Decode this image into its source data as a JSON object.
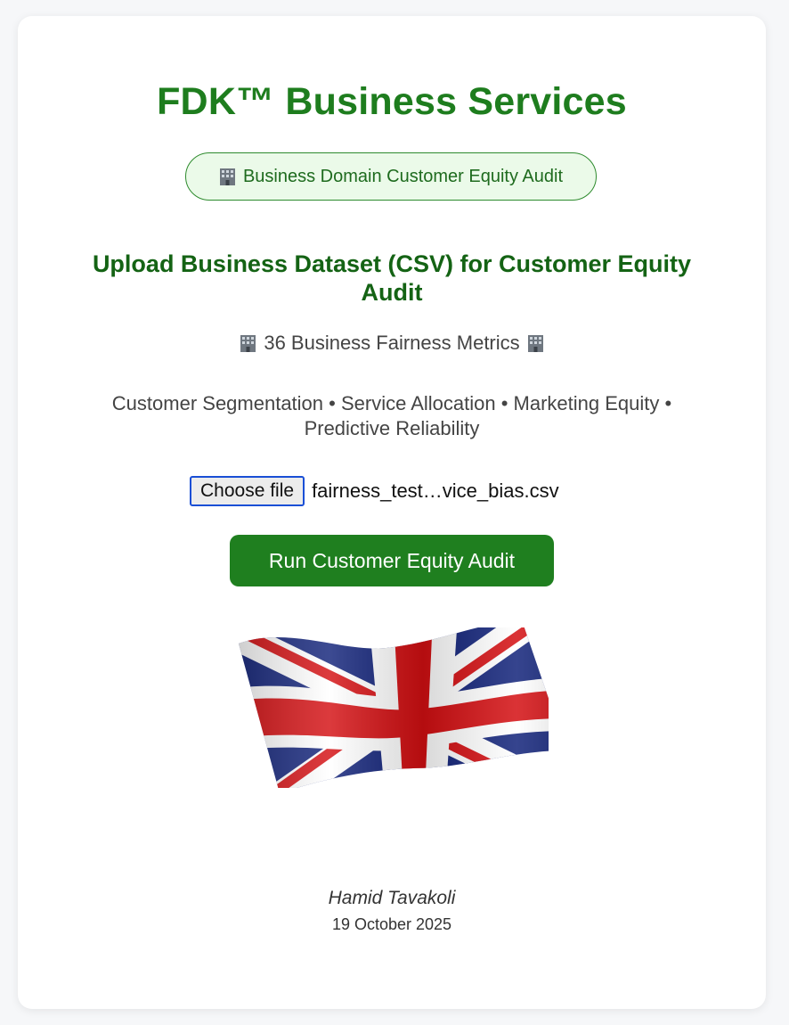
{
  "header": {
    "title": "FDK™ Business Services",
    "badge_label": "Business Domain Customer Equity Audit"
  },
  "upload": {
    "heading": "Upload Business Dataset (CSV) for Customer Equity Audit",
    "metrics_label": "36 Business Fairness Metrics",
    "categories": "Customer Segmentation • Service Allocation • Marketing Equity • Predictive Reliability",
    "choose_file_label": "Choose file",
    "selected_file": "fairness_test…vice_bias.csv",
    "run_button_label": "Run Customer Equity Audit"
  },
  "icons": {
    "building": "office-building-icon",
    "flag": "union-jack-flag"
  },
  "footer": {
    "author": "Hamid Tavakoli",
    "date": "19 October 2025"
  },
  "colors": {
    "title_green": "#1e7d1e",
    "button_green": "#1f7f1f",
    "badge_bg": "#ebfae9",
    "file_button_border": "#1a4fd6"
  }
}
